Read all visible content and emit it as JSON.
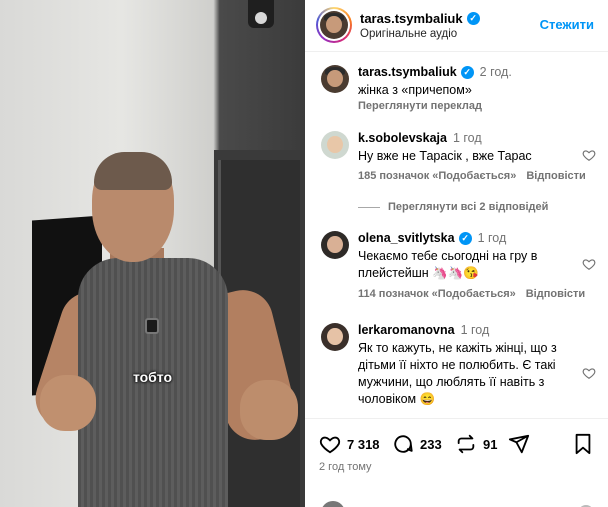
{
  "video": {
    "caption": "тобто"
  },
  "header": {
    "username": "taras.tsymbaliuk",
    "subtitle": "Оригінальне аудіо",
    "follow_label": "Стежити"
  },
  "post": {
    "username": "taras.tsymbaliuk",
    "time": "2 год.",
    "caption": "жінка з «причепом»",
    "translate_label": "Переглянути переклад"
  },
  "comments": [
    {
      "username": "k.sobolevskaja",
      "time": "1 год",
      "text": "Ну вже не Тарасік , вже Тарас",
      "likes": "185 позначок «Подобається»",
      "reply_label": "Відповісти",
      "view_replies": "Переглянути всі 2 відповідей"
    },
    {
      "username": "olena_svitlytska",
      "time": "1 год",
      "verified": true,
      "text": "Чекаємо тебе сьогодні на гру в плейстейшн 🦄🦄😘",
      "likes": "114 позначок «Подобається»",
      "reply_label": "Відповісти"
    },
    {
      "username": "lerkaromanovna",
      "time": "1 год",
      "text": "Як то кажуть, не кажіть жінці, що з дітьми її ніхто не полюбить. Є такі мужчини, що люблять її навіть з чоловіком 😄"
    }
  ],
  "actions": {
    "likes": "7 318",
    "comments": "233",
    "reposts": "91",
    "time_ago": "2 год тому"
  },
  "colors": {
    "accent": "#0095f6",
    "muted": "#737373"
  }
}
